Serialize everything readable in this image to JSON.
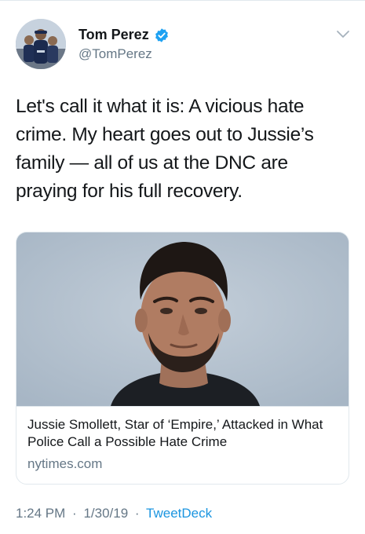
{
  "tweet": {
    "author_name": "Tom Perez",
    "author_handle": "@TomPerez",
    "text": "Let's call it what it is: A vicious hate crime. My heart goes out to Jussie’s family — all of us at the DNC are praying for his full recovery.",
    "card": {
      "title": "Jussie Smollett, Star of ‘Empire,’ Attacked in What Police Call a Possible Hate Crime",
      "domain": "nytimes.com"
    },
    "time": "1:24 PM",
    "date": "1/30/19",
    "source": "TweetDeck",
    "separator": "·"
  },
  "icons": {
    "avatar": "profile-photo",
    "verified": "verified-badge-icon",
    "menu": "chevron-down-icon"
  },
  "colors": {
    "text_primary": "#14171a",
    "text_secondary": "#657786",
    "link": "#1b95e0",
    "verified": "#1da1f2",
    "border": "#e1e8ed"
  }
}
